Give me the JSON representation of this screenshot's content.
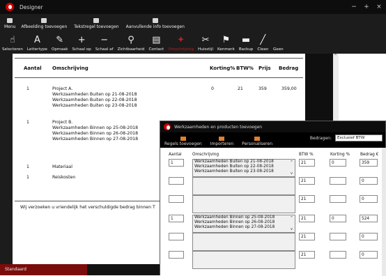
{
  "window": {
    "title": "Designer",
    "status": "Standaard"
  },
  "menu_row": [
    {
      "label": "Menu",
      "icon": "menu-icon"
    },
    {
      "label": "Afbeelding toevoegen",
      "icon": "image-icon"
    },
    {
      "label": "Tekstregel toevoegen",
      "icon": "text-line-icon"
    },
    {
      "label": "Aanvullende info toevoegen",
      "icon": "info-icon"
    }
  ],
  "toolbar": [
    {
      "label": "Selecteren",
      "icon": "hand-pointer-icon",
      "glyph": "☝"
    },
    {
      "label": "Lettertype",
      "icon": "font-icon",
      "glyph": "A"
    },
    {
      "label": "Opmaak",
      "icon": "pencil-icon",
      "glyph": "✎"
    },
    {
      "label": "Schaal op",
      "icon": "plus-icon",
      "glyph": "+"
    },
    {
      "label": "Schaal af",
      "icon": "minus-icon",
      "glyph": "−"
    },
    {
      "label": "Zichtbaarheid",
      "icon": "magnifier-icon",
      "glyph": "⚲"
    },
    {
      "label": "Contact",
      "icon": "contact-card-icon",
      "glyph": "▤"
    },
    {
      "label": "Omschrijving",
      "icon": "description-icon",
      "glyph": "✦",
      "disabled": true
    },
    {
      "label": "Huisstijl",
      "icon": "brush-icon",
      "glyph": "✂"
    },
    {
      "label": "Kenmerk",
      "icon": "stamp-icon",
      "glyph": "⚑"
    },
    {
      "label": "Backup",
      "icon": "folder-icon",
      "glyph": "▬"
    },
    {
      "label": "Clean",
      "icon": "broom-icon",
      "glyph": "╱"
    },
    {
      "label": "Geen",
      "icon": "none-icon",
      "glyph": ""
    }
  ],
  "document": {
    "headers": {
      "aantal": "Aantal",
      "omschrijving": "Omschrijving",
      "korting": "Korting%",
      "btw": "BTW%",
      "prijs": "Prijs",
      "bedrag": "Bedrag"
    },
    "rows": [
      {
        "aantal": "1",
        "lines": [
          "Project A.",
          "Werkzaamheden Buiten op 21-08-2018",
          "Werkzaamheden Buiten op 22-08-2018",
          "Werkzaamheden Buiten op 23-08-2018"
        ],
        "korting": "0",
        "btw": "21",
        "prijs": "359",
        "bedrag": "359,00"
      },
      {
        "aantal": "1",
        "lines": [
          "Project B.",
          "Werkzaamheden Binnen op 25-08-2018",
          "Werkzaamheden Binnen op 26-08-2018",
          "Werkzaamheden Binnen op 27-08-2018"
        ]
      },
      {
        "aantal": "1",
        "lines": [
          "Materiaal"
        ]
      },
      {
        "aantal": "1",
        "lines": [
          "Reiskosten"
        ]
      }
    ],
    "footer_text": "Wij verzoeken u vriendelijk het verschuldigde bedrag binnen T"
  },
  "dialog": {
    "title": "Werkzaamheden en producten toevoegen",
    "buttons": [
      {
        "label": "Regels toevoegen",
        "icon": "add-rows-icon"
      },
      {
        "label": "Importeren",
        "icon": "import-icon"
      },
      {
        "label": "Personaliseren",
        "icon": "personalize-icon"
      }
    ],
    "bedragen_label": "Bedragen:",
    "bedragen_value": "Exclusief BTW",
    "headers": {
      "aantal": "Aantal",
      "omschrijving": "Omschrijving",
      "btw": "BTW %",
      "korting": "Korting %",
      "bedrag": "Bedrag €"
    },
    "rows": [
      {
        "aantal": "1",
        "omschrijving": [
          "Werkzaamheden Buiten op 21-08-2018",
          "Werkzaamheden Buiten op 22-08-2018",
          "Werkzaamheden Buiten op 23-08-2018"
        ],
        "btw": "21",
        "korting": "0",
        "bedrag": "359"
      },
      {
        "aantal": "",
        "omschrijving": [],
        "btw": "21",
        "korting": "",
        "bedrag": "0"
      },
      {
        "aantal": "",
        "omschrijving": [],
        "btw": "21",
        "korting": "",
        "bedrag": "0"
      },
      {
        "aantal": "1",
        "omschrijving": [
          "Werkzaamheden Binnen op 25-08-2018",
          "Werkzaamheden Binnen op 26-08-2018",
          "Werkzaamheden Binnen op 27-08-2018"
        ],
        "btw": "21",
        "korting": "0",
        "bedrag": "524"
      },
      {
        "aantal": "",
        "omschrijving": [],
        "btw": "21",
        "korting": "",
        "bedrag": "0"
      },
      {
        "aantal": "",
        "omschrijving": [],
        "btw": "21",
        "korting": "",
        "bedrag": "0"
      }
    ]
  },
  "colors": {
    "chrome": "#1c1c1c",
    "accent_red": "#7a0c0c",
    "disabled_red": "#b22222"
  }
}
